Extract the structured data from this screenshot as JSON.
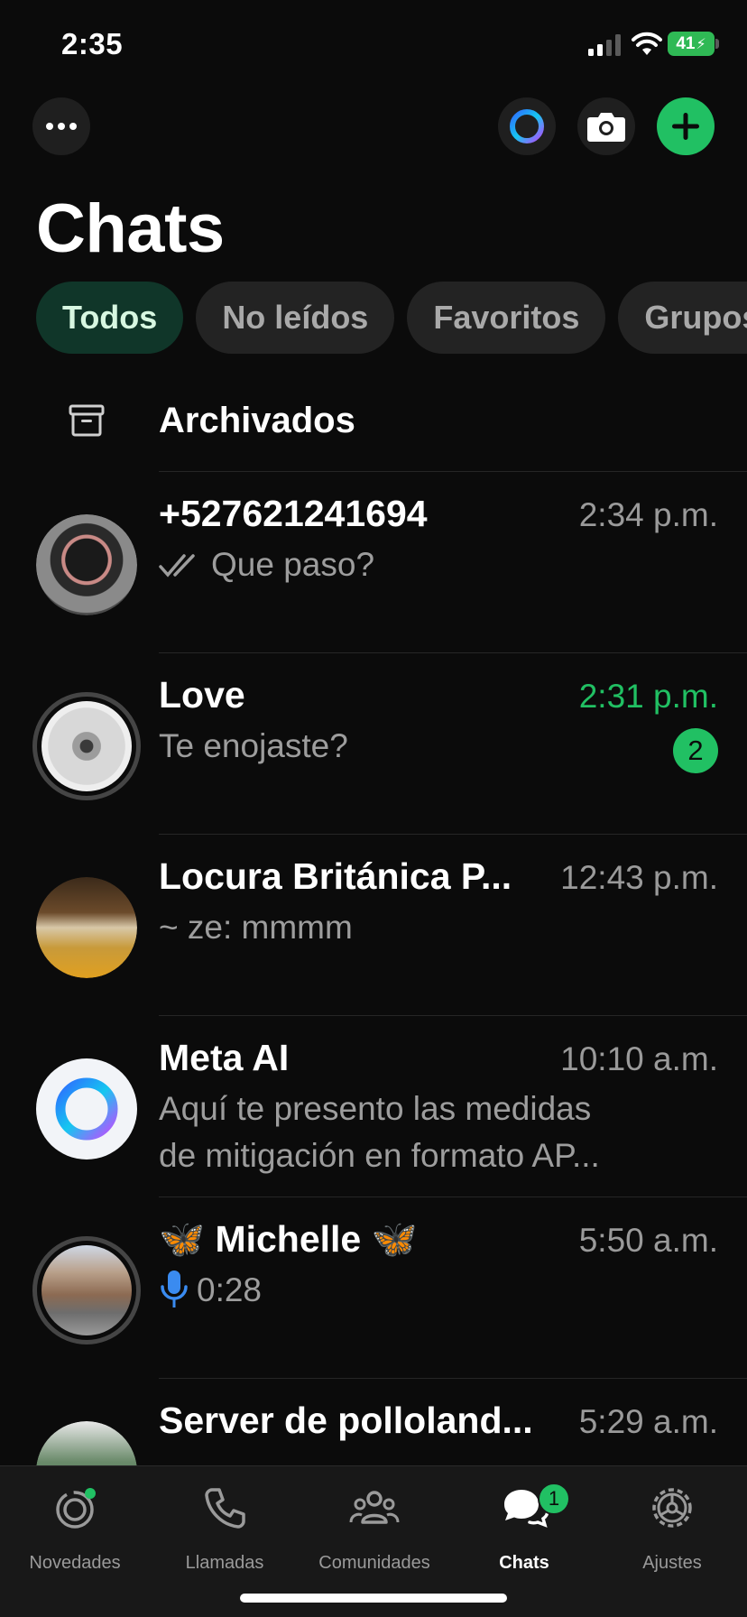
{
  "status_bar": {
    "time": "2:35",
    "battery": "41"
  },
  "header": {
    "title": "Chats"
  },
  "filters": [
    {
      "label": "Todos",
      "active": true
    },
    {
      "label": "No leídos",
      "active": false
    },
    {
      "label": "Favoritos",
      "active": false
    },
    {
      "label": "Grupos",
      "active": false
    }
  ],
  "archived": {
    "label": "Archivados"
  },
  "chats": [
    {
      "name": "+527621241694",
      "time": "2:34 p.m.",
      "preview": "Que paso?",
      "read_ticks": true
    },
    {
      "name": "Love",
      "time": "2:31 p.m.",
      "preview": "Te enojaste?",
      "unread_count": "2"
    },
    {
      "name": "Locura Británica P...",
      "time": "12:43 p.m.",
      "preview": "~ ze: mmmm"
    },
    {
      "name": "Meta AI",
      "time": "10:10 a.m.",
      "preview_line1": "Aquí te presento las medidas",
      "preview_line2": "de mitigación en formato AP..."
    },
    {
      "name": "🦋 Michelle 🦋",
      "time": "5:50 a.m.",
      "preview": "0:28"
    },
    {
      "name": "Server de pollolandia",
      "name_display": "Server de polloland...",
      "time": "5:29 a.m."
    }
  ],
  "tabbar": {
    "tabs": [
      {
        "label": "Novedades"
      },
      {
        "label": "Llamadas"
      },
      {
        "label": "Comunidades"
      },
      {
        "label": "Chats",
        "badge": "1"
      },
      {
        "label": "Ajustes"
      }
    ]
  },
  "colors": {
    "accent": "#21c063",
    "background": "#0b0b0b",
    "chip_active_bg": "#103629",
    "chip_bg": "#232323"
  }
}
